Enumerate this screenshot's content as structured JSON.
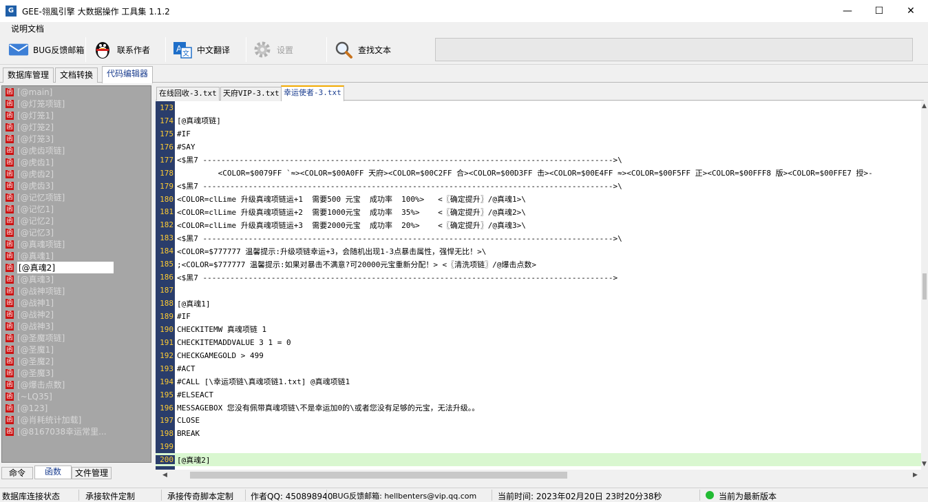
{
  "window": {
    "title": "GEE-翎風引擎 大数据操作 工具集  1.1.2",
    "minimize": "—",
    "maximize": "☐",
    "close": "✕"
  },
  "menu": {
    "docs": "说明文档"
  },
  "toolbar": {
    "bug_mail": "BUG反馈邮箱",
    "contact": "联系作者",
    "translate": "中文翻译",
    "settings": "设置",
    "find_text": "查找文本",
    "search_value": ""
  },
  "main_tabs": [
    "数据库管理",
    "文档转换",
    "代码编辑器"
  ],
  "sidebar": {
    "func_glyph": "函",
    "items": [
      "[@main]",
      "[@灯笼项链]",
      "[@灯笼1]",
      "[@灯笼2]",
      "[@灯笼3]",
      "[@虎齿项链]",
      "[@虎齿1]",
      "[@虎齿2]",
      "[@虎齿3]",
      "[@记忆项链]",
      "[@记忆1]",
      "[@记忆2]",
      "[@记忆3]",
      "[@真魂项链]",
      "[@真魂1]",
      "[@真魂2]",
      "[@真魂3]",
      "[@战神项链]",
      "[@战神1]",
      "[@战神2]",
      "[@战神3]",
      "[@圣魔项链]",
      "[@圣魔1]",
      "[@圣魔2]",
      "[@圣魔3]",
      "[@爆击点数]",
      "[~LQ35]",
      "[@123]",
      "[@肖耗统计加载]",
      "[@8167038幸运常里..."
    ],
    "selected_index": 15
  },
  "side_tabs": [
    "命令",
    "函数",
    "文件管理"
  ],
  "file_tabs": [
    "在线回收-3.txt",
    "天府VIP-3.txt",
    "幸运使者-3.txt"
  ],
  "editor": {
    "lines": [
      {
        "n": "173",
        "t": ""
      },
      {
        "n": "174",
        "t": "[@真魂项链]"
      },
      {
        "n": "175",
        "t": "#IF"
      },
      {
        "n": "176",
        "t": "#SAY"
      },
      {
        "n": "177",
        "t": "<$黑7 ------------------------------------------------------------------------------------------>\\"
      },
      {
        "n": "178",
        "t": "         <COLOR=$0079FF `≈><COLOR=$00A0FF 天府><COLOR=$00C2FF 合><COLOR=$00D3FF 击><COLOR=$00E4FF ≈><COLOR=$00F5FF 正><COLOR=$00FFF8 版><COLOR=$00FFE7 授>-"
      },
      {
        "n": "179",
        "t": "<$黑7 ------------------------------------------------------------------------------------------>\\"
      },
      {
        "n": "180",
        "t": "<COLOR=clLime 升级真魂项链运+1  需要500 元宝  成功率  100%>   <〖确定提升〗/@真魂1>\\"
      },
      {
        "n": "181",
        "t": "<COLOR=clLime 升级真魂项链运+2  需要1000元宝  成功率  35%>    <〖确定提升〗/@真魂2>\\"
      },
      {
        "n": "182",
        "t": "<COLOR=clLime 升级真魂项链运+3  需要2000元宝  成功率  20%>    <〖确定提升〗/@真魂3>\\"
      },
      {
        "n": "183",
        "t": "<$黑7 ------------------------------------------------------------------------------------------>\\"
      },
      {
        "n": "184",
        "t": "<COLOR=$777777 温馨提示:升级项链幸运+3，会随机出现1-3点暴击属性，强悍无比！>\\"
      },
      {
        "n": "185",
        "t": ";<COLOR=$777777 温馨提示:如果对暴击不满意?可20000元宝重新分配！> <〖清洗项链〗/@爆击点数>"
      },
      {
        "n": "186",
        "t": "<$黑7 ------------------------------------------------------------------------------------------>"
      },
      {
        "n": "187",
        "t": ""
      },
      {
        "n": "188",
        "t": "[@真魂1]"
      },
      {
        "n": "189",
        "t": "#IF"
      },
      {
        "n": "190",
        "t": "CHECKITEMW 真魂项链 1"
      },
      {
        "n": "191",
        "t": "CHECKITEMADDVALUE 3 1 = 0"
      },
      {
        "n": "192",
        "t": "CHECKGAMEGOLD > 499"
      },
      {
        "n": "193",
        "t": "#ACT"
      },
      {
        "n": "194",
        "t": "#CALL [\\幸运项链\\真魂项链1.txt] @真魂项链1"
      },
      {
        "n": "195",
        "t": "#ELSEACT"
      },
      {
        "n": "196",
        "t": "MESSAGEBOX 您没有佩带真魂项链\\不是幸运加0的\\或者您没有足够的元宝，无法升级。。"
      },
      {
        "n": "197",
        "t": "CLOSE"
      },
      {
        "n": "198",
        "t": "BREAK"
      },
      {
        "n": "199",
        "t": ""
      },
      {
        "n": "200",
        "t": "[@真魂2]"
      }
    ],
    "current_line": "200"
  },
  "statusbar": {
    "db_status": "数据库连接状态",
    "custom_software": "承接软件定制",
    "custom_script": "承接传奇脚本定制",
    "qq": "作者QQ: 450898940",
    "bug_mail": "BUG反馈邮箱: hellbenters@vip.qq.com",
    "time": "当前时间: 2023年02月20日 23时20分38秒",
    "version": "当前为最新版本"
  }
}
